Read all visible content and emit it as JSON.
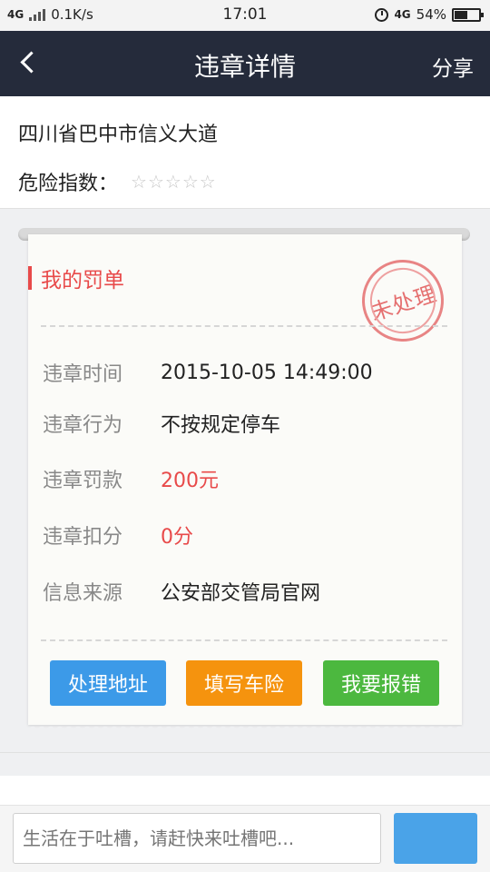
{
  "status_bar": {
    "network": "4G",
    "speed": "0.1K/s",
    "time": "17:01",
    "network_right": "4G",
    "battery_percent": "54%",
    "battery_level": 0.54
  },
  "nav": {
    "title": "违章详情",
    "share_label": "分享"
  },
  "location": {
    "address": "四川省巴中市信义大道",
    "risk_label": "危险指数：",
    "risk_rating": 0,
    "risk_max": 5
  },
  "ticket": {
    "heading": "我的罚单",
    "stamp_text": "未处理",
    "fields": [
      {
        "label": "违章时间",
        "value": "2015-10-05 14:49:00",
        "highlight": false
      },
      {
        "label": "违章行为",
        "value": "不按规定停车",
        "highlight": false
      },
      {
        "label": "违章罚款",
        "value": "200元",
        "highlight": true
      },
      {
        "label": "违章扣分",
        "value": "0分",
        "highlight": true
      },
      {
        "label": "信息来源",
        "value": "公安部交管局官网",
        "highlight": false
      }
    ],
    "buttons": [
      {
        "label": "处理地址",
        "color": "#3c9ae8"
      },
      {
        "label": "填写车险",
        "color": "#f5930e"
      },
      {
        "label": "我要报错",
        "color": "#4cb83f"
      }
    ]
  },
  "comment": {
    "placeholder": "生活在于吐槽，请赶快来吐槽吧..."
  },
  "colors": {
    "nav_bg": "#252b3b",
    "accent_red": "#e84a4a"
  }
}
